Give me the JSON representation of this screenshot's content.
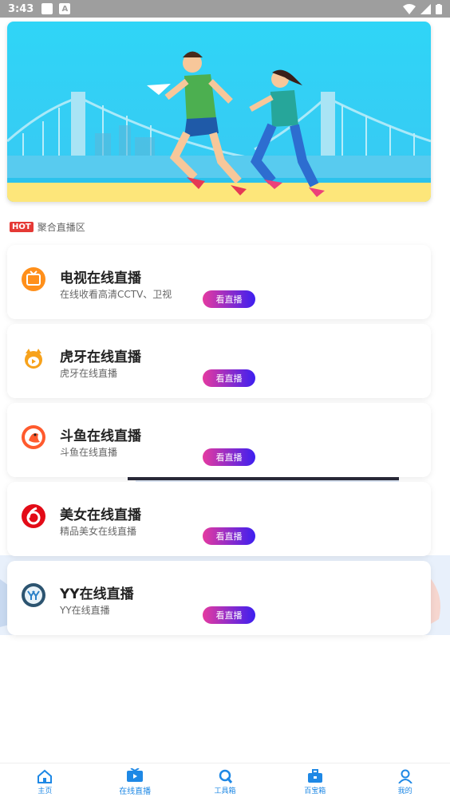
{
  "status_bar": {
    "time": "3:43",
    "a_badge": "A"
  },
  "section": {
    "hot": "HOT",
    "title": "聚合直播区"
  },
  "cards": [
    {
      "title": "电视在线直播",
      "subtitle": "在线收看高清CCTV、卫视",
      "button": "看直播"
    },
    {
      "title": "虎牙在线直播",
      "subtitle": "虎牙在线直播",
      "button": "看直播"
    },
    {
      "title": "斗鱼在线直播",
      "subtitle": "斗鱼在线直播",
      "button": "看直播"
    },
    {
      "title": "美女在线直播",
      "subtitle": "精品美女在线直播",
      "button": "看直播"
    },
    {
      "title": "YY在线直播",
      "subtitle": "YY在线直播",
      "button": "看直播"
    }
  ],
  "nav": [
    {
      "label": "主页"
    },
    {
      "label": "在线直播"
    },
    {
      "label": "工具箱"
    },
    {
      "label": "百宝箱"
    },
    {
      "label": "我的"
    }
  ],
  "colors": {
    "accent": "#1e88e5",
    "button_start": "#e53aa0",
    "button_end": "#3d1ff0",
    "hot": "#e53935"
  }
}
